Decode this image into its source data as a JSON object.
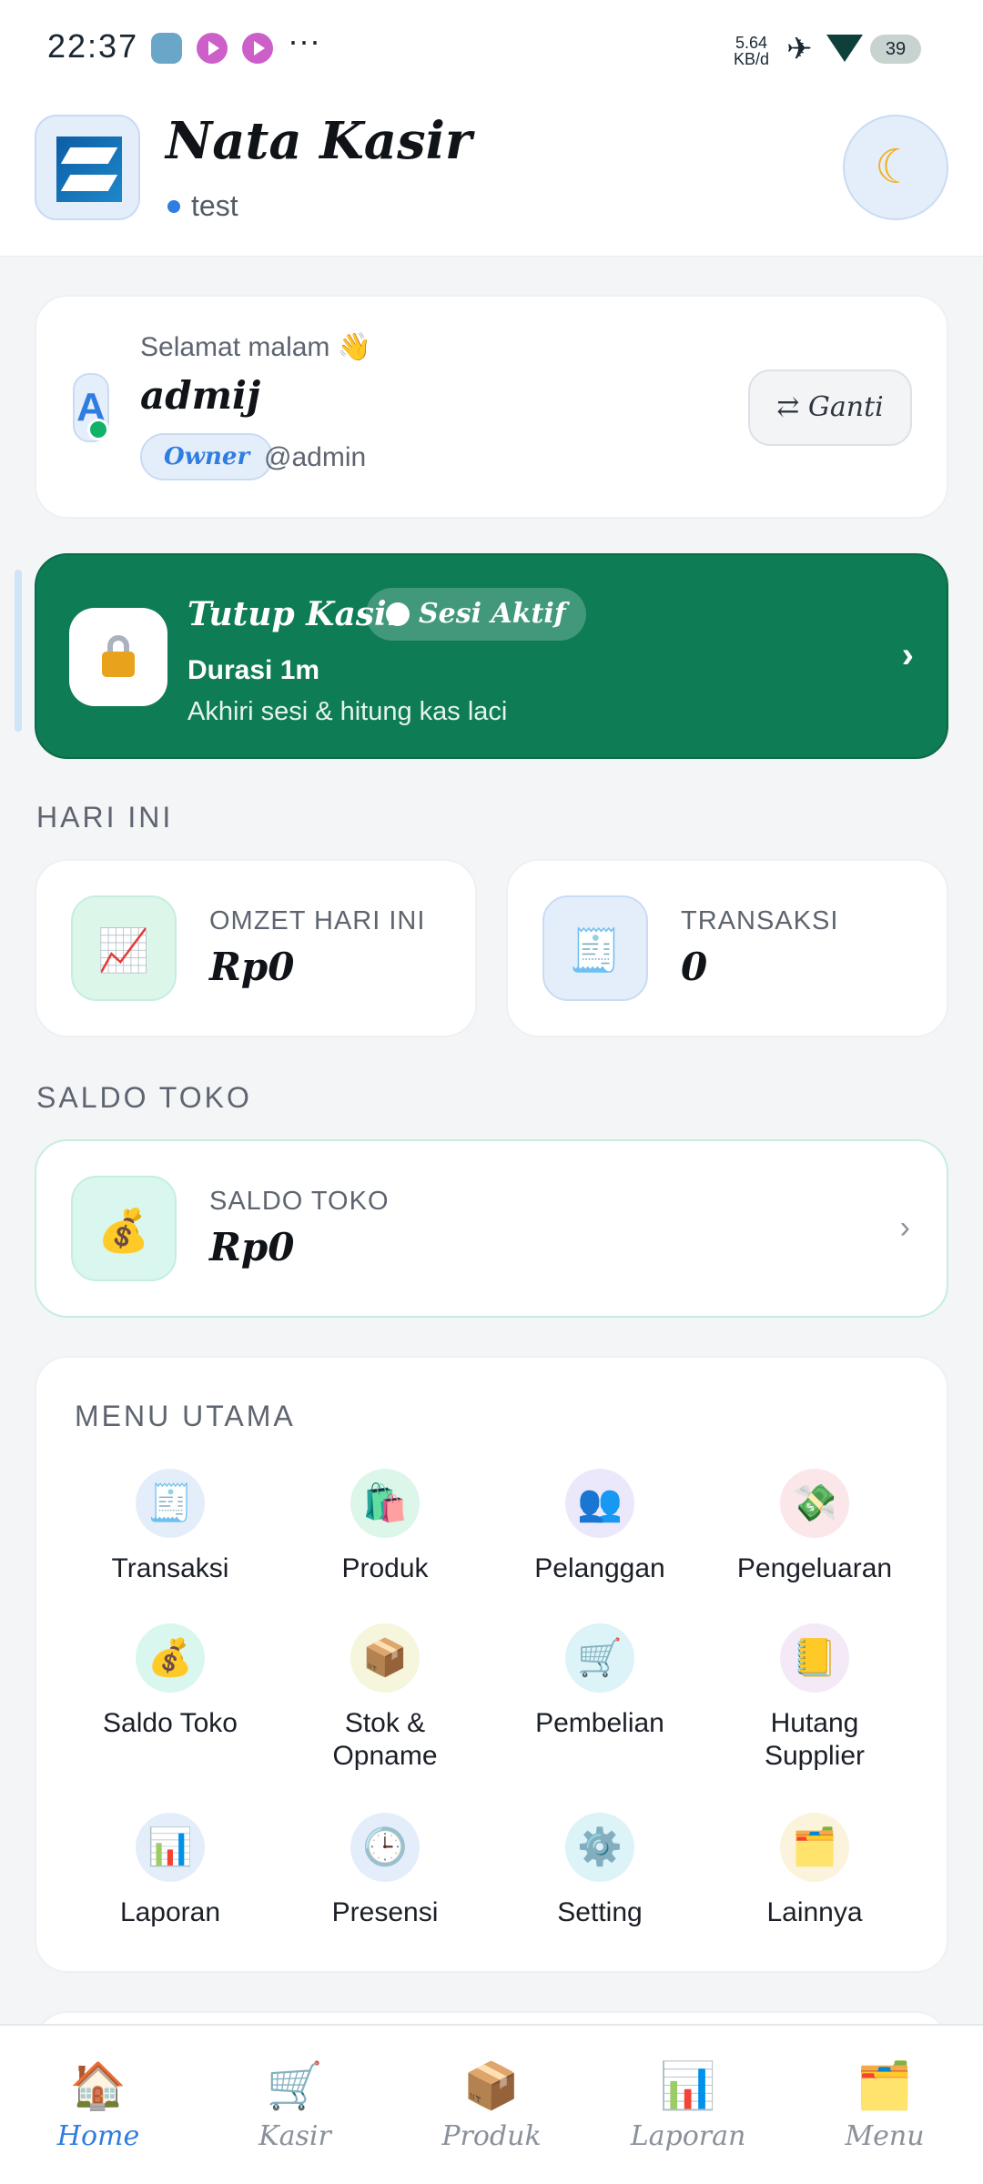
{
  "status_bar": {
    "time": "22:37",
    "more": "···",
    "net_speed_top": "5.64",
    "net_speed_bottom": "KB/d",
    "battery": "39"
  },
  "header": {
    "title": "Nata Kasir",
    "store_name": "test",
    "theme_toggle_icon": "moon-icon"
  },
  "greeting_card": {
    "greeting": "Selamat malam 👋",
    "avatar_letter": "A",
    "user_name": "admij",
    "role": "Owner",
    "handle": "@admin",
    "switch_label": "⇄  Ganti"
  },
  "session_card": {
    "title": "Tutup Kasir",
    "badge": "Sesi Aktif",
    "duration": "Durasi 1m",
    "subtitle": "Akhiri sesi & hitung kas laci",
    "chevron": "›"
  },
  "today": {
    "section_label": "HARI INI",
    "stats": [
      {
        "label": "OMZET HARI INI",
        "value": "Rp0",
        "icon": "chart-up-icon"
      },
      {
        "label": "TRANSAKSI",
        "value": "0",
        "icon": "receipt-icon"
      }
    ]
  },
  "balance": {
    "section_label": "SALDO TOKO",
    "label": "SALDO TOKO",
    "value": "Rp0",
    "chevron": "›",
    "icon": "money-bag-icon"
  },
  "menu": {
    "title": "MENU UTAMA",
    "items": [
      {
        "label": "Transaksi",
        "emoji": "🧾"
      },
      {
        "label": "Produk",
        "emoji": "🛍️"
      },
      {
        "label": "Pelanggan",
        "emoji": "👥"
      },
      {
        "label": "Pengeluaran",
        "emoji": "💸"
      },
      {
        "label": "Saldo Toko",
        "emoji": "💰"
      },
      {
        "label": "Stok & Opname",
        "emoji": "📦"
      },
      {
        "label": "Pembelian",
        "emoji": "🛒"
      },
      {
        "label": "Hutang Supplier",
        "emoji": "📒"
      },
      {
        "label": "Laporan",
        "emoji": "📊"
      },
      {
        "label": "Presensi",
        "emoji": "🕒"
      },
      {
        "label": "Setting",
        "emoji": "⚙️"
      },
      {
        "label": "Lainnya",
        "emoji": "🗂️"
      }
    ]
  },
  "bottom_nav": {
    "items": [
      {
        "label": "Home",
        "emoji": "🏠",
        "active": true
      },
      {
        "label": "Kasir",
        "emoji": "🛒",
        "active": false
      },
      {
        "label": "Produk",
        "emoji": "📦",
        "active": false
      },
      {
        "label": "Laporan",
        "emoji": "📊",
        "active": false
      },
      {
        "label": "Menu",
        "emoji": "🗂️",
        "active": false
      }
    ]
  },
  "colors": {
    "accent": "#2f7de1",
    "session_green": "#0e7c55",
    "online_dot": "#12b268"
  }
}
